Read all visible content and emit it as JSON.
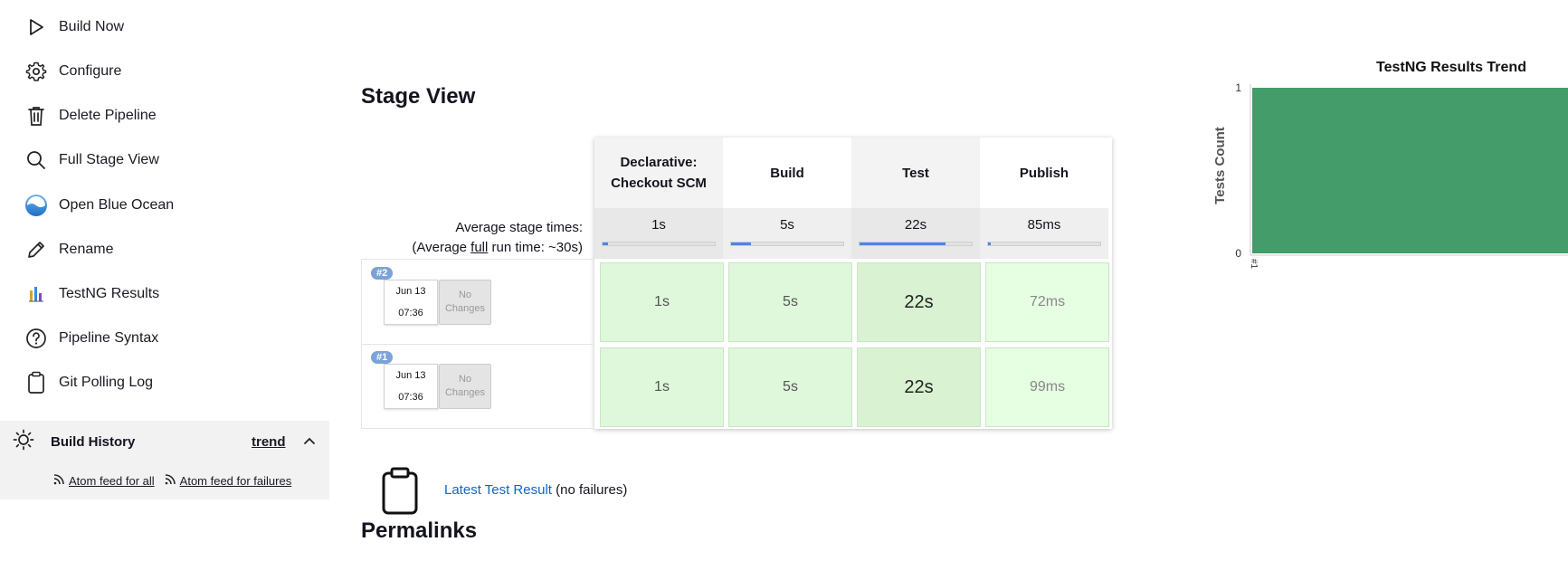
{
  "sidebar": {
    "items": [
      {
        "label": "Build Now",
        "icon": "play-icon"
      },
      {
        "label": "Configure",
        "icon": "gear-icon"
      },
      {
        "label": "Delete Pipeline",
        "icon": "trash-icon"
      },
      {
        "label": "Full Stage View",
        "icon": "search-icon"
      },
      {
        "label": "Open Blue Ocean",
        "icon": "blue-ocean-icon"
      },
      {
        "label": "Rename",
        "icon": "pencil-icon"
      },
      {
        "label": "TestNG Results",
        "icon": "testng-chart-icon"
      },
      {
        "label": "Pipeline Syntax",
        "icon": "help-circle-icon"
      },
      {
        "label": "Git Polling Log",
        "icon": "clipboard-icon"
      }
    ],
    "build_history": {
      "title": "Build History",
      "trend": "trend",
      "feed_all": "Atom feed for all",
      "feed_failures": "Atom feed for failures"
    }
  },
  "stage_view": {
    "title": "Stage View",
    "stages": [
      "Declarative: Checkout SCM",
      "Build",
      "Test",
      "Publish"
    ],
    "average_label": "Average stage times:",
    "average_run_prefix": "(Average ",
    "average_run_link": "full",
    "average_run_suffix": " run time: ~30s)",
    "average_times": [
      "1s",
      "5s",
      "22s",
      "85ms"
    ],
    "average_fraction": [
      0.05,
      0.18,
      0.77,
      0.01
    ],
    "runs": [
      {
        "badge": "#2",
        "date": "Jun 13",
        "time": "07:36",
        "changes": "No Changes",
        "times": [
          "1s",
          "5s",
          "22s",
          "72ms"
        ]
      },
      {
        "badge": "#1",
        "date": "Jun 13",
        "time": "07:36",
        "changes": "No Changes",
        "times": [
          "1s",
          "5s",
          "22s",
          "99ms"
        ]
      }
    ]
  },
  "test_result": {
    "link": "Latest Test Result",
    "suffix": " (no failures)"
  },
  "permalinks": {
    "title": "Permalinks"
  },
  "chart_data": {
    "type": "area",
    "title": "TestNG Results Trend",
    "xlabel": "",
    "ylabel": "Tests Count",
    "categories": [
      "#1"
    ],
    "series": [
      {
        "values": [
          1
        ],
        "color": "#439c69"
      }
    ],
    "ylim": [
      0,
      1
    ],
    "yticks": [
      "0",
      "1"
    ]
  },
  "colors": {
    "link": "#1565c0",
    "success_cell": "#dff7da",
    "chart_green": "#439c69",
    "badge": "#7ca3d8"
  }
}
